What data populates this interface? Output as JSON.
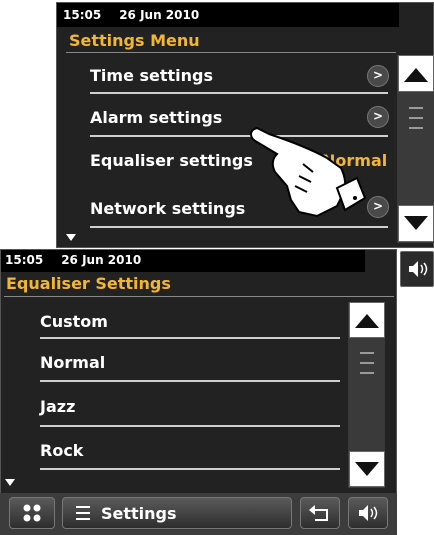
{
  "top_screen": {
    "status": {
      "time": "15:05",
      "date": "26 Jun 2010"
    },
    "title": "Settings Menu",
    "items": [
      {
        "label": "Time settings",
        "chevron": ">"
      },
      {
        "label": "Alarm settings",
        "chevron": ">"
      },
      {
        "label": "Equaliser settings",
        "value": "Normal"
      },
      {
        "label": "Network settings",
        "chevron": ">"
      }
    ]
  },
  "bottom_screen": {
    "status": {
      "time": "15:05",
      "date": "26 Jun 2010"
    },
    "title": "Equaliser Settings",
    "items": [
      {
        "label": "Custom"
      },
      {
        "label": "Normal"
      },
      {
        "label": "Jazz"
      },
      {
        "label": "Rock"
      }
    ],
    "bottom_bar": {
      "settings_label": "Settings"
    }
  },
  "colors": {
    "accent": "#f2b632",
    "screen_bg": "#222222"
  },
  "icons": [
    "scroll-up-icon",
    "scroll-down-icon",
    "volume-icon",
    "grid-icon",
    "menu-icon",
    "back-icon",
    "pointing-hand-icon"
  ]
}
